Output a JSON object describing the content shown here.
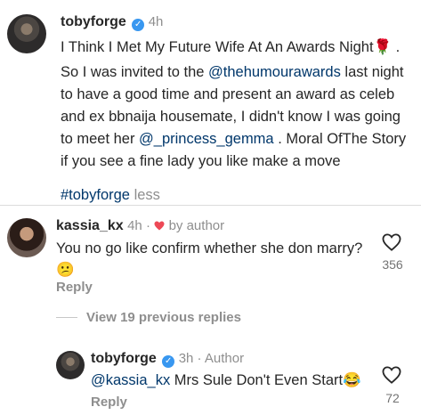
{
  "post": {
    "username": "tobyforge",
    "time": "4h",
    "title": "I Think I Met My Future Wife At An Awards Night",
    "title_emoji": "🌹",
    "line1_prefix": "So I was invited to the ",
    "mention_awards": "@thehumourawards",
    "line1_suffix": " last night",
    "line2": "to have a good time and present an award as celeb",
    "line3": "and ex bbnaija housemate, I didn't know I was going",
    "line4_prefix": "to meet her ",
    "mention_gemma": "@_princess_gemma",
    "line4_suffix": " . Moral OfThe Story",
    "line5": "if you see a fine lady you like make a move",
    "hashtag": "#tobyforge",
    "less": " less"
  },
  "comment1": {
    "username": "kassia_kx",
    "time": "4h",
    "dot": " · ",
    "by_author": "by author",
    "text": "You no go like confirm whether she don marry?",
    "emoji": "😕",
    "reply": "Reply",
    "likes": "356"
  },
  "view_replies": "View 19 previous replies",
  "reply1": {
    "username": "tobyforge",
    "time": "3h",
    "dot": " · ",
    "author": "Author",
    "mention": "@kassia_kx",
    "text": " Mrs Sule Don't Even Start",
    "emoji": "😂",
    "reply": "Reply",
    "likes": "72"
  },
  "colors": {
    "verified": "#3897f0",
    "link": "#00376b",
    "heart_red": "#ed4956",
    "muted": "#8e8e8e"
  }
}
